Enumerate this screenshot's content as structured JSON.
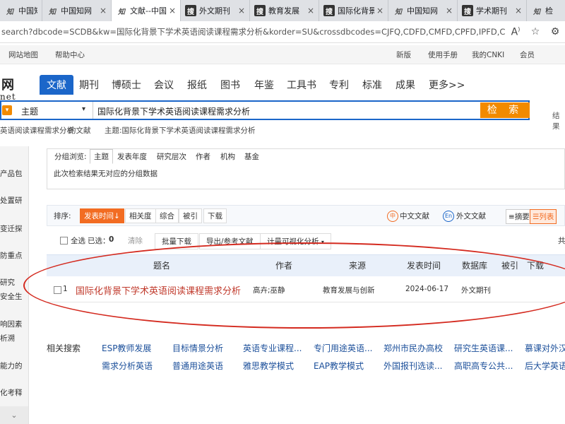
{
  "browser": {
    "tabs": [
      {
        "label": "中国知网",
        "icon": "zhi"
      },
      {
        "label": "中国知网",
        "icon": "zhi"
      },
      {
        "label": "文献--中国",
        "icon": "zhi",
        "active": true
      },
      {
        "label": "外文期刊",
        "icon": "sou"
      },
      {
        "label": "教育发展",
        "icon": "sou"
      },
      {
        "label": "国际化背景",
        "icon": "sou"
      },
      {
        "label": "中国知网",
        "icon": "zhi"
      },
      {
        "label": "学术期刊",
        "icon": "sou"
      },
      {
        "label": "检",
        "icon": "zhi"
      }
    ],
    "close_glyph": "×",
    "url": "search?dbcode=SCDB&kw=国际化背景下学术英语阅读课程需求分析&korder=SU&crossdbcodes=CJFQ,CDFD,CMFD,CPFD,IPFD,CCN..."
  },
  "topnav": {
    "site_map": "网站地图",
    "help": "帮助中心",
    "new_version": "新版",
    "manual": "使用手册",
    "my_cnki": "我的CNKI",
    "member": "会员"
  },
  "logo": {
    "line1": "网",
    "line2": "net"
  },
  "categories": [
    "文献",
    "期刊",
    "博硕士",
    "会议",
    "报纸",
    "图书",
    "年鉴",
    "工具书",
    "专利",
    "标准",
    "成果",
    "更多>>"
  ],
  "search": {
    "field": "主题",
    "query": "国际化背景下学术英语阅读课程需求分析",
    "button": "检 索",
    "side": "结果"
  },
  "crumbs": {
    "left": "英语阅读课程需求分析",
    "left_suffix": "的文献",
    "topic": "主题:国际化背景下学术英语阅读课程需求分析"
  },
  "sidebar": [
    "产品包",
    "处置研",
    "变迁探",
    "防重点",
    "研究",
    "安全生",
    "响因素",
    "析溯",
    "能力的",
    "化考释"
  ],
  "group": {
    "label": "分组浏览:",
    "tabs": [
      "主题",
      "发表年度",
      "研究层次",
      "作者",
      "机构",
      "基金"
    ],
    "message": "此次检索结果无对应的分组数据"
  },
  "sort": {
    "label": "排序:",
    "selected": "发表时间",
    "options": [
      "相关度",
      "综合",
      "被引",
      "下载"
    ],
    "zh": "中文文献",
    "en": "外文文献",
    "view_abstract": "摘要",
    "view_list": "列表"
  },
  "actions": {
    "select_all": "全选",
    "selected": "已选：",
    "selected_count": "0",
    "clear": "清除",
    "batch_download": "批量下载",
    "export": "导出/参考文献",
    "visual": "计量可视化分析",
    "right_edge": "共"
  },
  "table": {
    "headers": [
      "题名",
      "作者",
      "来源",
      "发表时间",
      "数据库",
      "被引",
      "下载"
    ],
    "rows": [
      {
        "index": "1",
        "title": "国际化背景下学术英语阅读课程需求分析",
        "authors": "高卉;巫静",
        "source": "教育发展与创新",
        "date": "2024-06-17",
        "database": "外文期刊"
      }
    ]
  },
  "related": {
    "heading": "相关搜索",
    "row1": [
      "ESP教师发展",
      "目标情景分析",
      "英语专业课程...",
      "专门用途英语...",
      "郑州市民办高校",
      "研究生英语课...",
      "慕课对外汉"
    ],
    "row2": [
      "需求分析英语",
      "普通用途英语",
      "雅思教学模式",
      "EAP教学模式",
      "外国报刊选读...",
      "高职高专公共...",
      "后大学英语"
    ]
  },
  "colors": {
    "brand_blue": "#1b66c9",
    "orange": "#f28a00",
    "annotation_red": "#d42a1f"
  }
}
